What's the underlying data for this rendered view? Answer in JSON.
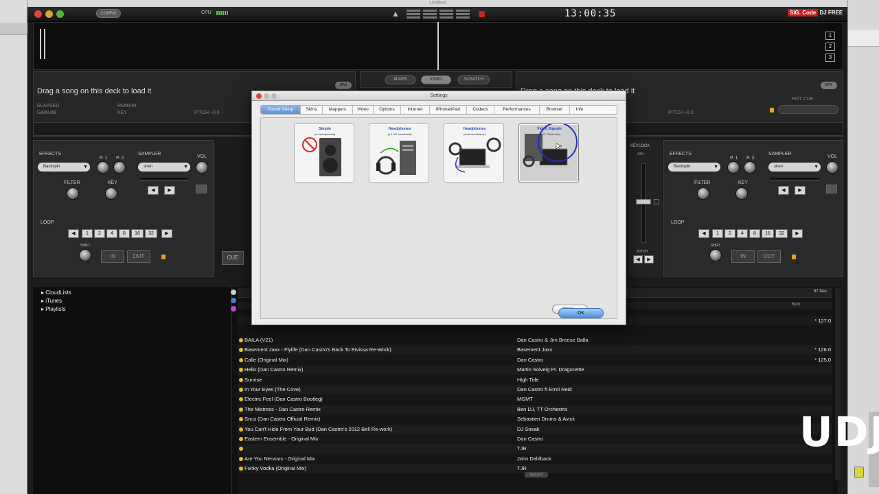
{
  "window": {
    "title": "Untitled",
    "config_label": "CONFIG",
    "cpu_label": "CPU",
    "clock": "13:00:35",
    "brand_prefix": "SIG. Code",
    "brand": "DJ FREE",
    "deck_numbers": [
      "1",
      "2",
      "3"
    ]
  },
  "decks": {
    "left": {
      "drag_text": "Drag a song on this deck to load it",
      "elapsed": "ELAPSED",
      "remain": "REMAIN",
      "gain": "GAIN dB",
      "key": "KEY",
      "pitch": "PITCH +0.0",
      "bpm": "BPM",
      "effects": "EFFECTS",
      "p1": "P. 1",
      "p2": "P. 2",
      "sampler": "SAMPLER",
      "vol": "VOL",
      "effect_value": "Backspin",
      "sampler_value": "siren",
      "filter": "FILTER",
      "key_ctl": "KEY",
      "loop": "LOOP",
      "loop_sizes": [
        "1",
        "2",
        "4",
        "8",
        "16",
        "32"
      ],
      "shift": "SHIFT",
      "in": "IN",
      "out": "OUT",
      "cue": "CUE"
    },
    "right": {
      "drag_text": "Drag a song on this deck to load it",
      "pitch": "PITCH +0.0",
      "bpm": "BPM",
      "hot_cue": "HOT CUE",
      "effects": "EFFECTS",
      "p1": "P. 1",
      "p2": "P. 2",
      "sampler": "SAMPLER",
      "vol": "VOL",
      "effect_value": "Backspin",
      "sampler_value": "siren",
      "filter": "FILTER",
      "key_ctl": "KEY",
      "loop": "LOOP",
      "loop_sizes": [
        "1",
        "2",
        "4",
        "8",
        "16",
        "32"
      ],
      "shift": "SHIFT",
      "in": "IN",
      "out": "OUT",
      "keylock": "KEYLOCK",
      "keylock_pct": "33%",
      "pitch_label": "PITCH"
    }
  },
  "mixer_tabs": [
    "MIXER",
    "VIDEO",
    "SCRATCH"
  ],
  "browser": {
    "tree": [
      "CloudLists",
      "iTunes",
      "Playlists"
    ],
    "count": "67 files",
    "bpm_header": "Bpm",
    "side_list": "SIDE LIST",
    "tracks": [
      {
        "title": "BAILA (V21)",
        "artist": "Dan Castro & Jim Breese Balla",
        "bpm": ""
      },
      {
        "title": "Basement Jaxx - Flylife (Dan Castro's Back To Eivissa Re-Work)",
        "artist": "Basement Jaxx",
        "bpm": "* 126.0"
      },
      {
        "title": "Calle (Original Mix)",
        "artist": "Dan Castro",
        "bpm": "* 125.0"
      },
      {
        "title": "Hello (Dan Castro Remix)",
        "artist": "Martin Solveig Ft. Dragonette",
        "bpm": ""
      },
      {
        "title": "Sunrise",
        "artist": "High Tide",
        "bpm": ""
      },
      {
        "title": "In Your Eyes (The Cove)",
        "artist": "Dan Castro ft Errol Reid",
        "bpm": ""
      },
      {
        "title": "Electric Feel (Dan Castro Bootleg)",
        "artist": "MGMT",
        "bpm": ""
      },
      {
        "title": "The Mistress - Dan Castro Remix",
        "artist": "Ben DJ, TT Orchestra",
        "bpm": ""
      },
      {
        "title": "Snus (Dan Castro Official Remix)",
        "artist": "Sebastien Drums & Avicii",
        "bpm": ""
      },
      {
        "title": "You Can't Hide From Your Bud (Dan Castro's 2012 Bell Re-work)",
        "artist": "DJ Sneak",
        "bpm": ""
      },
      {
        "title": "Eastern Ensemble - Original Mix",
        "artist": "Dan Castro",
        "bpm": ""
      },
      {
        "title": "",
        "artist": "TJR",
        "bpm": ""
      },
      {
        "title": "Are You Nervous - Original Mix",
        "artist": "John Dahlback",
        "bpm": ""
      },
      {
        "title": "Funky Vodka (Original Mix)",
        "artist": "TJR",
        "bpm": ""
      }
    ],
    "partial_bpm": "* 127.0"
  },
  "settings": {
    "title": "Settings",
    "tabs": [
      "Sound Setup",
      "Skins",
      "Mappers",
      "Video",
      "Options",
      "Internet",
      "iPhone/iPad",
      "Codecs",
      "Performances",
      "Browser",
      "Info"
    ],
    "active_tab": "Sound Setup",
    "presets": [
      {
        "caption": "Simple",
        "sub": "(no headphones)"
      },
      {
        "caption": "Headphones",
        "sub": "(4.1 HD soundcard)"
      },
      {
        "caption": "Headphones",
        "sub": "(dual soundcards)"
      },
      {
        "caption": "Video Signals",
        "sub": "(DVS / Timecode)"
      }
    ],
    "more_label": "More...",
    "ok_label": "OK"
  },
  "watermark": "UDJ",
  "colors": {
    "accent": "#5a8fd6",
    "record": "#c21d1d",
    "cpu": "#5ad04a",
    "lock": "#e8a020"
  }
}
